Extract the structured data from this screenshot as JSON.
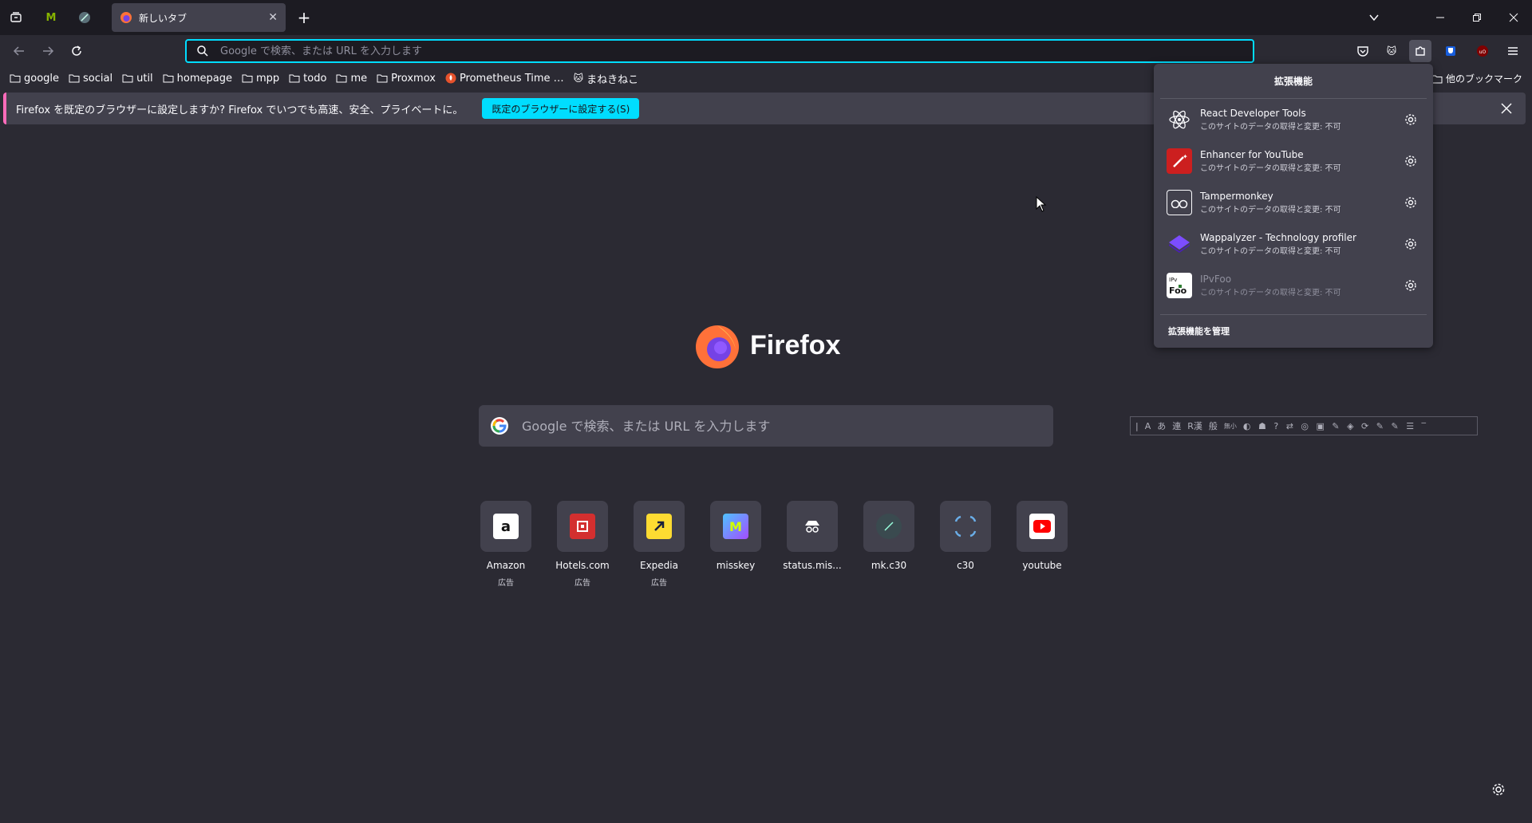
{
  "tab": {
    "title": "新しいタブ",
    "new_tab": "+"
  },
  "urlbar": {
    "placeholder": "Google で検索、または URL を入力します"
  },
  "bookmarks": {
    "items": [
      {
        "label": "google",
        "icon": "folder-icon"
      },
      {
        "label": "social",
        "icon": "folder-icon"
      },
      {
        "label": "util",
        "icon": "folder-icon"
      },
      {
        "label": "homepage",
        "icon": "folder-icon"
      },
      {
        "label": "mpp",
        "icon": "folder-icon"
      },
      {
        "label": "todo",
        "icon": "folder-icon"
      },
      {
        "label": "me",
        "icon": "folder-icon"
      },
      {
        "label": "Proxmox",
        "icon": "folder-icon"
      },
      {
        "label": "Prometheus Time …",
        "icon": "prometheus-icon"
      },
      {
        "label": "まねきねこ",
        "icon": "cat-icon"
      }
    ],
    "other": "他のブックマーク"
  },
  "notification": {
    "message": "Firefox を既定のブラウザーに設定しますか? Firefox でいつでも高速、安全、プライベートに。",
    "button": "既定のブラウザーに設定する(S)"
  },
  "main": {
    "logo_text": "Firefox",
    "search_placeholder": "Google で検索、または URL を入力します",
    "ime_toolbar": [
      "|",
      "A",
      "あ",
      "連",
      "R漢",
      "般",
      "無小"
    ]
  },
  "shortcuts": [
    {
      "label": "Amazon",
      "sub": "広告",
      "color": "#ffffff"
    },
    {
      "label": "Hotels.com",
      "sub": "広告",
      "color": "#d32f2f"
    },
    {
      "label": "Expedia",
      "sub": "広告",
      "color": "#fddb32"
    },
    {
      "label": "misskey",
      "sub": "",
      "color": "#6d5bd0"
    },
    {
      "label": "status.mis...",
      "sub": "",
      "color": "#2b2a33"
    },
    {
      "label": "mk.c30",
      "sub": "",
      "color": "#3a4a4f"
    },
    {
      "label": "c30",
      "sub": "",
      "color": "#2b2a33"
    },
    {
      "label": "youtube",
      "sub": "",
      "color": "#ffffff"
    }
  ],
  "extensions": {
    "title": "拡張機能",
    "items": [
      {
        "name": "React Developer Tools",
        "perm": "このサイトのデータの取得と変更: 不可",
        "icon": "react-icon"
      },
      {
        "name": "Enhancer for YouTube",
        "perm": "このサイトのデータの取得と変更: 不可",
        "icon": "magic-wand-icon"
      },
      {
        "name": "Tampermonkey",
        "perm": "このサイトのデータの取得と変更: 不可",
        "icon": "tampermonkey-icon"
      },
      {
        "name": "Wappalyzer - Technology profiler",
        "perm": "このサイトのデータの取得と変更: 不可",
        "icon": "wappalyzer-icon"
      },
      {
        "name": "IPvFoo",
        "perm": "このサイトのデータの取得と変更: 不可",
        "icon": "ipvfoo-icon",
        "disabled": true
      }
    ],
    "manage": "拡張機能を管理"
  },
  "colors": {
    "accent": "#00ddff",
    "bg": "#2b2a33",
    "panel": "#42414d",
    "notif_border": "#ff6bba"
  }
}
